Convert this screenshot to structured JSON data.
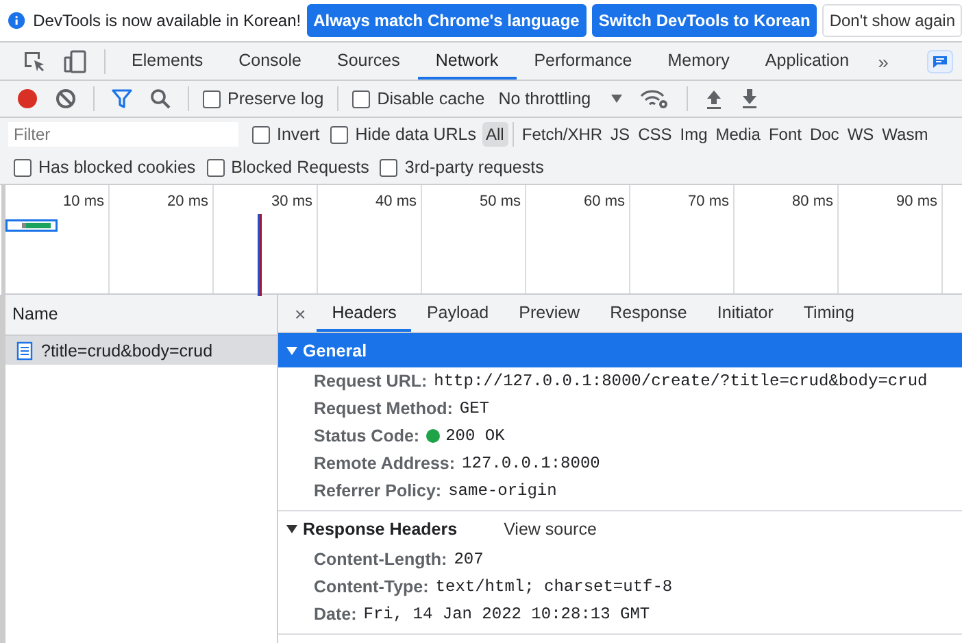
{
  "infobar": {
    "message": "DevTools is now available in Korean!",
    "buttons": [
      {
        "label": "Always match Chrome's language",
        "kind": "primary"
      },
      {
        "label": "Switch DevTools to Korean",
        "kind": "primary"
      },
      {
        "label": "Don't show again",
        "kind": "secondary"
      }
    ]
  },
  "main_tabs": [
    {
      "label": "Elements",
      "selected": false
    },
    {
      "label": "Console",
      "selected": false
    },
    {
      "label": "Sources",
      "selected": false
    },
    {
      "label": "Network",
      "selected": true
    },
    {
      "label": "Performance",
      "selected": false
    },
    {
      "label": "Memory",
      "selected": false
    },
    {
      "label": "Application",
      "selected": false
    }
  ],
  "more_tabs": "»",
  "toolbar": {
    "recording": true,
    "filter_active": true,
    "checkboxes": [
      {
        "label": "Preserve log",
        "checked": false
      },
      {
        "label": "Disable cache",
        "checked": false
      }
    ],
    "throttling": "No throttling"
  },
  "filter": {
    "placeholder": "Filter",
    "checkboxes": [
      {
        "label": "Invert",
        "checked": false
      },
      {
        "label": "Hide data URLs",
        "checked": false
      }
    ],
    "types": [
      {
        "label": "All",
        "selected": true
      },
      {
        "label": "Fetch/XHR",
        "selected": false
      },
      {
        "label": "JS",
        "selected": false
      },
      {
        "label": "CSS",
        "selected": false
      },
      {
        "label": "Img",
        "selected": false
      },
      {
        "label": "Media",
        "selected": false
      },
      {
        "label": "Font",
        "selected": false
      },
      {
        "label": "Doc",
        "selected": false
      },
      {
        "label": "WS",
        "selected": false
      },
      {
        "label": "Wasm",
        "selected": false
      }
    ]
  },
  "blocked_filters": [
    {
      "label": "Has blocked cookies",
      "checked": false
    },
    {
      "label": "Blocked Requests",
      "checked": false
    },
    {
      "label": "3rd-party requests",
      "checked": false
    }
  ],
  "overview": {
    "ticks": [
      "10 ms",
      "20 ms",
      "30 ms",
      "40 ms",
      "50 ms",
      "60 ms",
      "70 ms",
      "80 ms",
      "90 ms"
    ]
  },
  "requests": {
    "column": "Name",
    "rows": [
      {
        "name": "?title=crud&body=crud",
        "selected": true
      }
    ]
  },
  "details": {
    "close": "×",
    "tabs": [
      {
        "label": "Headers",
        "selected": true
      },
      {
        "label": "Payload",
        "selected": false
      },
      {
        "label": "Preview",
        "selected": false
      },
      {
        "label": "Response",
        "selected": false
      },
      {
        "label": "Initiator",
        "selected": false
      },
      {
        "label": "Timing",
        "selected": false
      }
    ],
    "sections": [
      {
        "title": "General",
        "selected": true,
        "expanded": true,
        "fields": [
          {
            "label": "Request URL:",
            "value": "http://127.0.0.1:8000/create/?title=crud&body=crud"
          },
          {
            "label": "Request Method:",
            "value": "GET"
          },
          {
            "label": "Status Code:",
            "value": "200 OK",
            "color": "#1ea446"
          },
          {
            "label": "Remote Address:",
            "value": "127.0.0.1:8000"
          },
          {
            "label": "Referrer Policy:",
            "value": "same-origin"
          }
        ]
      },
      {
        "title": "Response Headers",
        "selected": false,
        "expanded": true,
        "action": "View source",
        "fields": [
          {
            "label": "Content-Length:",
            "value": "207"
          },
          {
            "label": "Content-Type:",
            "value": "text/html; charset=utf-8"
          },
          {
            "label": "Date:",
            "value": "Fri, 14 Jan 2022 10:28:13 GMT"
          }
        ]
      }
    ]
  }
}
